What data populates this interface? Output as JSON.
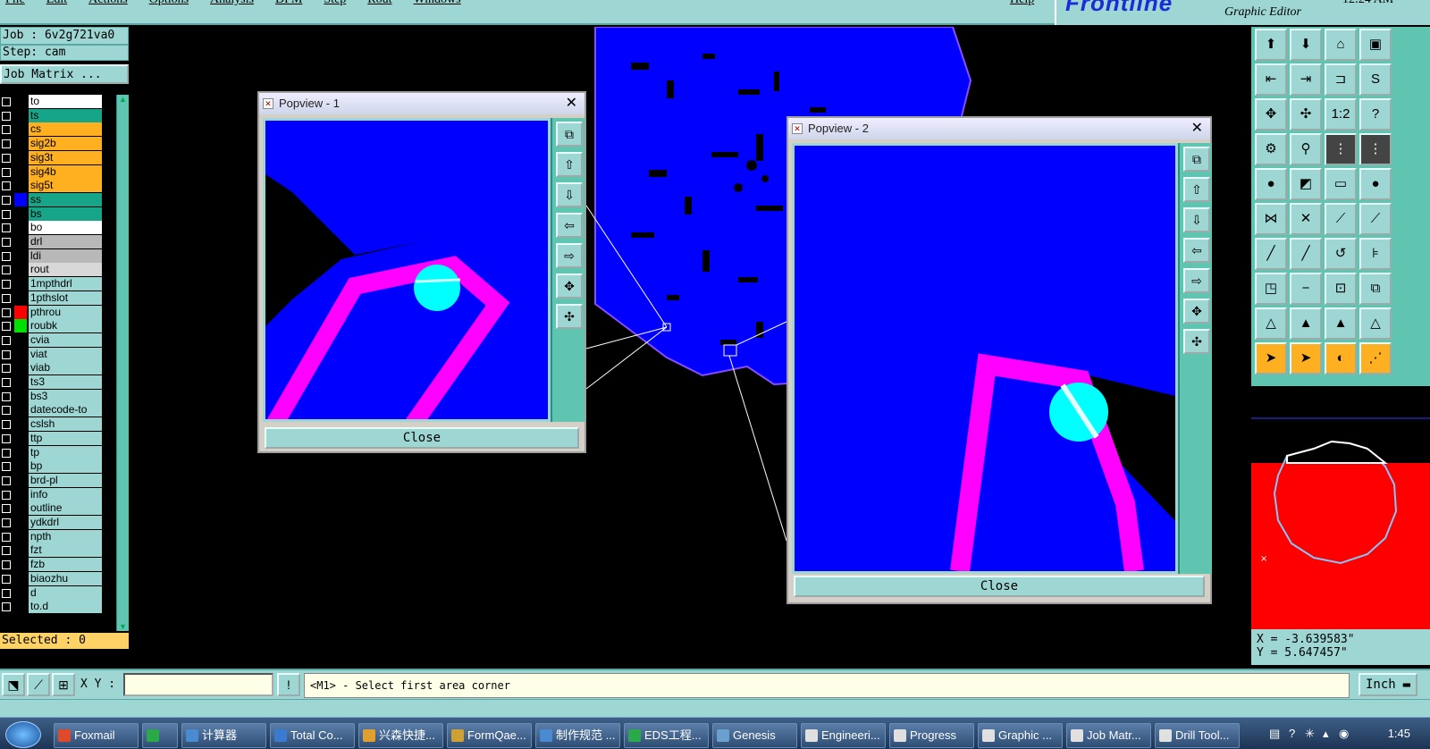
{
  "menu": {
    "items": [
      "File",
      "Edit",
      "Actions",
      "Options",
      "Analysis",
      "DFM",
      "Step",
      "Rout",
      "Windows"
    ],
    "help": "Help"
  },
  "brand": {
    "logo": "Frontline",
    "subtitle": "Graphic Editor",
    "time": "12:24 AM"
  },
  "left": {
    "job": "Job : 6v2g721va0",
    "step": "Step: cam",
    "matrix_button": "Job Matrix ...",
    "selected": "Selected : 0"
  },
  "layers": [
    {
      "name": "to",
      "color": "#ffffff",
      "swatch": "#000000",
      "arrow": true
    },
    {
      "name": "ts",
      "color": "#17a589",
      "swatch": "#000000",
      "arrow": true
    },
    {
      "name": "cs",
      "color": "#ffb020",
      "swatch": "#000000",
      "arrow": true
    },
    {
      "name": "sig2b",
      "color": "#ffb020",
      "swatch": "#000000",
      "arrow": true
    },
    {
      "name": "sig3t",
      "color": "#ffb020",
      "swatch": "#000000",
      "arrow": false
    },
    {
      "name": "sig4b",
      "color": "#ffb020",
      "swatch": "#000000",
      "arrow": false
    },
    {
      "name": "sig5t",
      "color": "#ffb020",
      "swatch": "#000000",
      "arrow": true
    },
    {
      "name": "ss",
      "color": "#17a589",
      "swatch": "#0000ff",
      "arrow": true
    },
    {
      "name": "bs",
      "color": "#17a589",
      "swatch": "#000000",
      "arrow": true
    },
    {
      "name": "bo",
      "color": "#ffffff",
      "swatch": "#000000",
      "arrow": true
    },
    {
      "name": "drl",
      "color": "#b8b8b8",
      "swatch": "#000000",
      "arrow": false
    },
    {
      "name": "ldi",
      "color": "#b8b8b8",
      "swatch": "#000000",
      "arrow": false
    },
    {
      "name": "rout",
      "color": "#d8d8d8",
      "swatch": "#000000",
      "arrow": false
    },
    {
      "name": "1mpthdrl",
      "color": "#9ed6d3",
      "swatch": "#000000",
      "arrow": false
    },
    {
      "name": "1pthslot",
      "color": "#9ed6d3",
      "swatch": "#000000",
      "arrow": false
    },
    {
      "name": "pthrou",
      "color": "#9ed6d3",
      "swatch": "#ff0000",
      "arrow": false
    },
    {
      "name": "roubk",
      "color": "#9ed6d3",
      "swatch": "#00e000",
      "arrow": false
    },
    {
      "name": "cvia",
      "color": "#9ed6d3",
      "swatch": "#000000",
      "arrow": false
    },
    {
      "name": "viat",
      "color": "#9ed6d3",
      "swatch": "#000000",
      "arrow": false
    },
    {
      "name": "viab",
      "color": "#9ed6d3",
      "swatch": "#000000",
      "arrow": false
    },
    {
      "name": "ts3",
      "color": "#9ed6d3",
      "swatch": "#000000",
      "arrow": false
    },
    {
      "name": "bs3",
      "color": "#9ed6d3",
      "swatch": "#000000",
      "arrow": false
    },
    {
      "name": "datecode-to",
      "color": "#9ed6d3",
      "swatch": "#000000",
      "arrow": false
    },
    {
      "name": "cslsh",
      "color": "#9ed6d3",
      "swatch": "#000000",
      "arrow": false
    },
    {
      "name": "ttp",
      "color": "#9ed6d3",
      "swatch": "#000000",
      "arrow": false
    },
    {
      "name": "tp",
      "color": "#9ed6d3",
      "swatch": "#000000",
      "arrow": false
    },
    {
      "name": "bp",
      "color": "#9ed6d3",
      "swatch": "#000000",
      "arrow": false
    },
    {
      "name": "brd-pl",
      "color": "#9ed6d3",
      "swatch": "#000000",
      "arrow": false
    },
    {
      "name": "info",
      "color": "#9ed6d3",
      "swatch": "#000000",
      "arrow": false
    },
    {
      "name": "outline",
      "color": "#9ed6d3",
      "swatch": "#000000",
      "arrow": true
    },
    {
      "name": "ydkdrl",
      "color": "#9ed6d3",
      "swatch": "#000000",
      "arrow": false
    },
    {
      "name": "npth",
      "color": "#9ed6d3",
      "swatch": "#000000",
      "arrow": false
    },
    {
      "name": "fzt",
      "color": "#9ed6d3",
      "swatch": "#000000",
      "arrow": false
    },
    {
      "name": "fzb",
      "color": "#9ed6d3",
      "swatch": "#000000",
      "arrow": false
    },
    {
      "name": "biaozhu",
      "color": "#9ed6d3",
      "swatch": "#000000",
      "arrow": false
    },
    {
      "name": "d",
      "color": "#9ed6d3",
      "swatch": "#000000",
      "arrow": false
    },
    {
      "name": "to.d",
      "color": "#9ed6d3",
      "swatch": "#000000",
      "arrow": true
    }
  ],
  "popview1": {
    "title": "Popview - 1",
    "close": "Close"
  },
  "popview2": {
    "title": "Popview - 2",
    "close": "Close"
  },
  "coords": {
    "x": "X = -3.639583\"",
    "y": "Y = 5.647457\""
  },
  "status": {
    "xy_label": "X Y :",
    "xy_value": "",
    "message": "<M1> - Select first area corner",
    "unit": "Inch"
  },
  "taskbar": {
    "items": [
      "Foxmail",
      "",
      "计算器",
      "Total Co...",
      "兴森快捷...",
      "FormQae...",
      "制作规范 ...",
      "EDS工程...",
      "Genesis",
      "Engineeri...",
      "Progress",
      "Graphic ...",
      "Job Matr...",
      "Drill Tool..."
    ],
    "clock": "1:45"
  },
  "colors": {
    "panel": "#9ed6d3",
    "board": "#0000ff",
    "trace": "#ff00ff",
    "pad": "#00ffff",
    "accent": "#5fc5b0"
  }
}
